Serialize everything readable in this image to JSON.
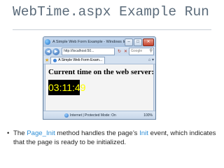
{
  "slide": {
    "title": "WebTime.aspx Example Run",
    "bullet": {
      "part1": "The ",
      "code1": "Page_Init",
      "part2": " method handles the page’s ",
      "code2": "Init",
      "part3": " event, which indicates that the page is ready to be initialized."
    }
  },
  "browser": {
    "window_title": "A Simple Web Form Example - Windows Interne...",
    "address": "http://localhost:50...",
    "search_placeholder": "Google",
    "tab_label": "A Simple Web Form Exam...",
    "status_text": "Internet | Protected Mode: On",
    "zoom": "100%"
  },
  "webpage": {
    "heading": "Current time on the web server:",
    "time": "03:11:49"
  },
  "colors": {
    "title": "#5b6b7a",
    "code": "#2e8ed6",
    "time_bg": "#000000",
    "time_fg": "#ffff00"
  },
  "icons": [
    "ie-logo-icon",
    "back-icon",
    "forward-icon",
    "refresh-icon",
    "stop-icon",
    "search-icon",
    "favorites-star-icon",
    "page-icon",
    "globe-icon"
  ]
}
